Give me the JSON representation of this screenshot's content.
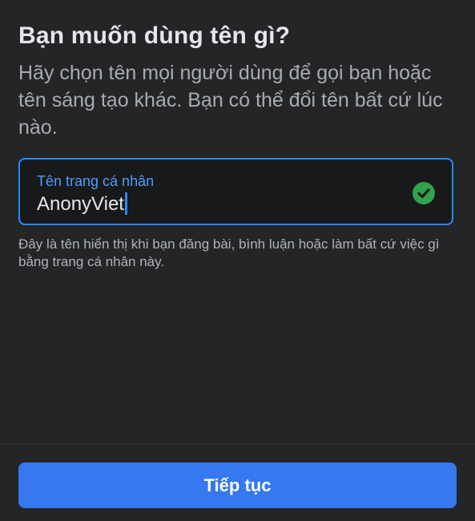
{
  "header": {
    "title": "Bạn muốn dùng tên gì?",
    "subtitle": "Hãy chọn tên mọi người dùng để gọi bạn hoặc tên sáng tạo khác. Bạn có thể đổi tên bất cứ lúc nào."
  },
  "profile_name_field": {
    "label": "Tên trang cá nhân",
    "value": "AnonyViet",
    "status_icon": "check-circle-icon",
    "helper_text": "Đây là tên hiển thị khi bạn đăng bài, bình luận hoặc làm bất cứ việc gì bằng trang cá nhân này."
  },
  "footer": {
    "continue_label": "Tiếp tục"
  },
  "colors": {
    "background": "#242526",
    "accent": "#2d88ff",
    "button": "#3578f0",
    "success": "#31a24c"
  }
}
